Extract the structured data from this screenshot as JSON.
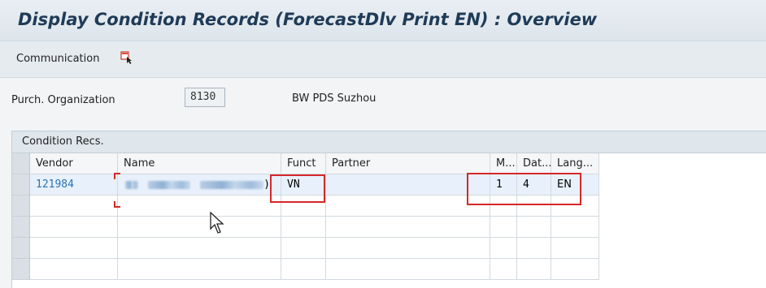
{
  "window": {
    "title": "Display Condition Records (ForecastDlv Print EN) : Overview"
  },
  "toolbar": {
    "communication_label": "Communication",
    "icon": "document-pointer-icon"
  },
  "header_field": {
    "label": "Purch. Organization",
    "value": "8130",
    "description": "BW PDS Suzhou"
  },
  "table": {
    "title": "Condition Recs.",
    "columns": [
      "Vendor",
      "Name",
      "Funct",
      "Partner",
      "M...",
      "Dat...",
      "Lang..."
    ],
    "rows": [
      {
        "vendor": "121984",
        "name_suffix": ")",
        "funct": "VN",
        "partner": "",
        "medium": "1",
        "date": "4",
        "language": "EN"
      }
    ],
    "empty_rows": 4
  },
  "colors": {
    "title": "#1f3b57",
    "highlight": "#d42828",
    "link": "#2a73b8",
    "selected_row": "#e8f1fb"
  }
}
